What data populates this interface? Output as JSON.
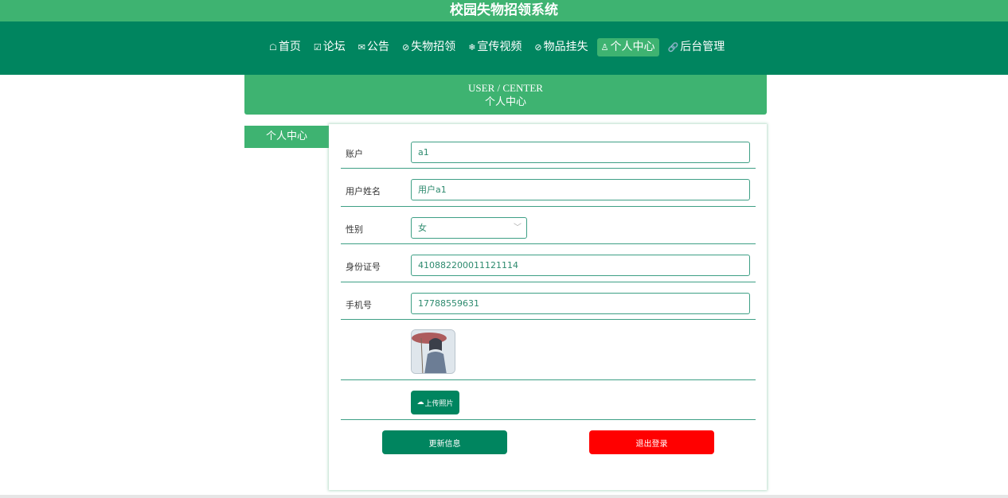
{
  "site": {
    "title": "校园失物招领系统"
  },
  "nav": {
    "items": [
      {
        "icon": "home-icon",
        "glyph": "☖",
        "label": "首页"
      },
      {
        "icon": "forum-icon",
        "glyph": "☑",
        "label": "论坛"
      },
      {
        "icon": "mail-icon",
        "glyph": "✉",
        "label": "公告"
      },
      {
        "icon": "lost-found-icon",
        "glyph": "⊘",
        "label": "失物招领"
      },
      {
        "icon": "video-icon",
        "glyph": "❄",
        "label": "宣传视频"
      },
      {
        "icon": "item-icon",
        "glyph": "⊘",
        "label": "物品挂失"
      },
      {
        "icon": "user-icon",
        "glyph": "♙",
        "label": "个人中心"
      },
      {
        "icon": "link-icon",
        "glyph": "🔗",
        "label": "后台管理"
      }
    ],
    "active_index": 6
  },
  "banner": {
    "en": "USER / CENTER",
    "cn": "个人中心"
  },
  "sidebar": {
    "tab_label": "个人中心"
  },
  "form": {
    "account": {
      "label": "账户",
      "value": "a1"
    },
    "username": {
      "label": "用户姓名",
      "value": "用户a1"
    },
    "gender": {
      "label": "性别",
      "value": "女"
    },
    "id_number": {
      "label": "身份证号",
      "value": "410882200011121114"
    },
    "phone": {
      "label": "手机号",
      "value": "17788559631"
    },
    "upload_label": "上传照片"
  },
  "actions": {
    "update_label": "更新信息",
    "logout_label": "退出登录"
  },
  "colors": {
    "header": "#3eb371",
    "nav": "#00855f",
    "accent": "#3e9f85",
    "logout": "#ff0000"
  }
}
